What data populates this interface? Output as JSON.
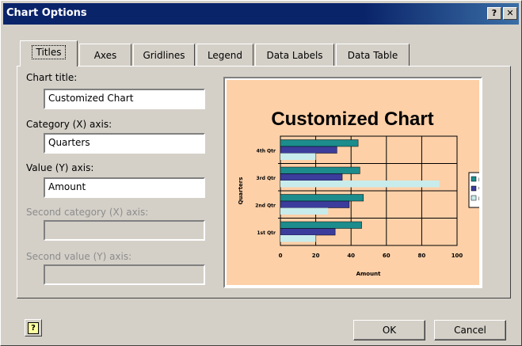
{
  "window": {
    "title": "Chart Options",
    "help_glyph": "?",
    "close_glyph": "✕"
  },
  "tabs": [
    "Titles",
    "Axes",
    "Gridlines",
    "Legend",
    "Data Labels",
    "Data Table"
  ],
  "active_tab": "Titles",
  "form": {
    "chart_title_label": "Chart title:",
    "chart_title_value": "Customized Chart",
    "category_label": "Category (X) axis:",
    "category_value": "Quarters",
    "value_label": "Value (Y) axis:",
    "value_value": "Amount",
    "second_category_label": "Second category (X) axis:",
    "second_category_value": "",
    "second_value_label": "Second value (Y) axis:",
    "second_value_value": ""
  },
  "buttons": {
    "ok": "OK",
    "cancel": "Cancel"
  },
  "chart_data": {
    "type": "bar",
    "orientation": "horizontal",
    "title": "Customized Chart",
    "xlabel": "Amount",
    "ylabel": "Quarters",
    "categories": [
      "1st Qtr",
      "2nd Qtr",
      "3rd Qtr",
      "4th Qtr"
    ],
    "series": [
      {
        "name": "North",
        "values": [
          46,
          47,
          45,
          44
        ],
        "color": "#1c8c8c"
      },
      {
        "name": "West",
        "values": [
          31,
          39,
          35,
          32
        ],
        "color": "#3c3c9c"
      },
      {
        "name": "East",
        "values": [
          20,
          27,
          90,
          20
        ],
        "color": "#c8ecec"
      }
    ],
    "xlim": [
      0,
      100
    ],
    "xticks": [
      "0",
      "20",
      "40",
      "60",
      "80",
      "100"
    ],
    "grid": true,
    "legend": "right",
    "background": "#fdd0a8"
  }
}
